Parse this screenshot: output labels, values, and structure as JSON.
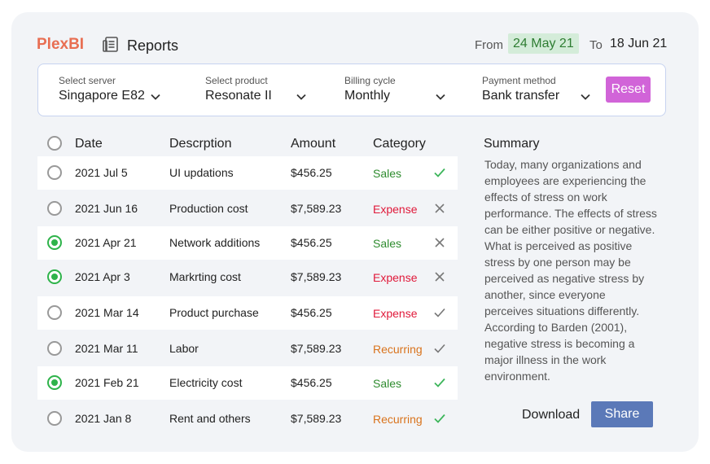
{
  "brand": "PlexBI",
  "header": {
    "icon": "report-document-icon",
    "title": "Reports",
    "from_label": "From",
    "from_date": "24 May 21",
    "to_label": "To",
    "to_date": "18 Jun 21"
  },
  "filters": [
    {
      "label": "Select server",
      "value": "Singapore E82"
    },
    {
      "label": "Select product",
      "value": "Resonate II"
    },
    {
      "label": "Billing cycle",
      "value": "Monthly"
    },
    {
      "label": "Payment method",
      "value": "Bank transfer"
    }
  ],
  "reset_label": "Reset",
  "table": {
    "headers": {
      "date": "Date",
      "description": "Descrption",
      "amount": "Amount",
      "category": "Category"
    },
    "rows": [
      {
        "date": "2021 Jul 5",
        "description": "UI updations",
        "amount": "$456.25",
        "category": "Sales",
        "selected": false,
        "status": "check-green"
      },
      {
        "date": "2021 Jun 16",
        "description": "Production cost",
        "amount": "$7,589.23",
        "category": "Expense",
        "selected": false,
        "status": "cross-gray"
      },
      {
        "date": "2021 Apr 21",
        "description": "Network additions",
        "amount": "$456.25",
        "category": "Sales",
        "selected": true,
        "status": "cross-gray"
      },
      {
        "date": "2021 Apr 3",
        "description": "Markrting cost",
        "amount": "$7,589.23",
        "category": "Expense",
        "selected": true,
        "status": "cross-gray"
      },
      {
        "date": "2021 Mar 14",
        "description": "Product purchase",
        "amount": "$456.25",
        "category": "Expense",
        "selected": false,
        "status": "check-gray"
      },
      {
        "date": "2021 Mar 11",
        "description": "Labor",
        "amount": "$7,589.23",
        "category": "Recurring",
        "selected": false,
        "status": "check-gray"
      },
      {
        "date": "2021 Feb 21",
        "description": "Electricity cost",
        "amount": "$456.25",
        "category": "Sales",
        "selected": true,
        "status": "check-green"
      },
      {
        "date": "2021 Jan 8",
        "description": "Rent and others",
        "amount": "$7,589.23",
        "category": "Recurring",
        "selected": false,
        "status": "check-green"
      }
    ]
  },
  "category_colors": {
    "Sales": "#2e8b2e",
    "Expense": "#e0193a",
    "Recurring": "#d9731c"
  },
  "summary": {
    "title": "Summary",
    "text": "Today, many organizations and employees are experiencing the effects of stress on work performance. The effects of stress can be either positive or negative. What is perceived as positive stress by one person may be perceived as negative stress by another, since everyone perceives situations differently. According to Barden (2001), negative stress is becoming a major illness in the work environment."
  },
  "actions": {
    "download_label": "Download",
    "share_label": "Share"
  },
  "colors": {
    "brand": "#e86e52",
    "reset": "#d164d8",
    "share": "#5b79b8",
    "date_highlight_bg": "#d4ecd9"
  }
}
